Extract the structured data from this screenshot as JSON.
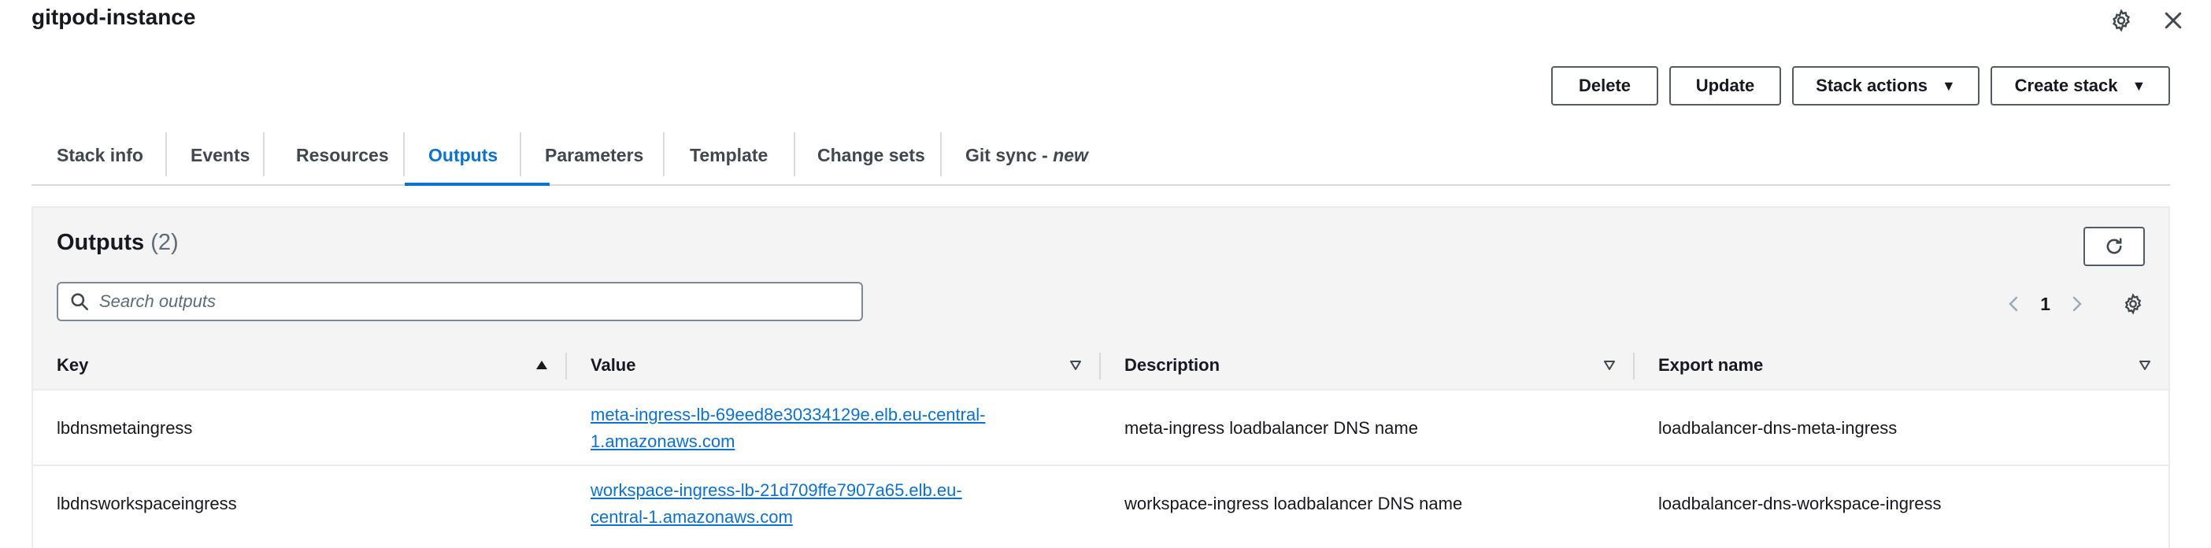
{
  "header": {
    "title": "gitpod-instance"
  },
  "actions": {
    "delete_label": "Delete",
    "update_label": "Update",
    "stack_actions_label": "Stack actions",
    "create_stack_label": "Create stack"
  },
  "tabs": [
    {
      "label": "Stack info"
    },
    {
      "label": "Events"
    },
    {
      "label": "Resources"
    },
    {
      "label": "Outputs"
    },
    {
      "label": "Parameters"
    },
    {
      "label": "Template"
    },
    {
      "label": "Change sets"
    },
    {
      "label": "Git sync - ",
      "suffix": "new"
    }
  ],
  "active_tab": "Outputs",
  "outputs": {
    "title": "Outputs",
    "count": "(2)",
    "search_placeholder": "Search outputs",
    "page": "1",
    "columns": [
      "Key",
      "Value",
      "Description",
      "Export name"
    ],
    "rows": [
      {
        "key": "lbdnsmetaingress",
        "value": "meta-ingress-lb-69eed8e30334129e.elb.eu-central-1.amazonaws.com",
        "description": "meta-ingress loadbalancer DNS name",
        "export_name": "loadbalancer-dns-meta-ingress"
      },
      {
        "key": "lbdnsworkspaceingress",
        "value": "workspace-ingress-lb-21d709ffe7907a65.elb.eu-central-1.amazonaws.com",
        "description": "workspace-ingress loadbalancer DNS name",
        "export_name": "loadbalancer-dns-workspace-ingress"
      }
    ]
  },
  "colors": {
    "accent": "#0972d3",
    "border": "#545b64",
    "header_bg": "#f4f4f4"
  }
}
